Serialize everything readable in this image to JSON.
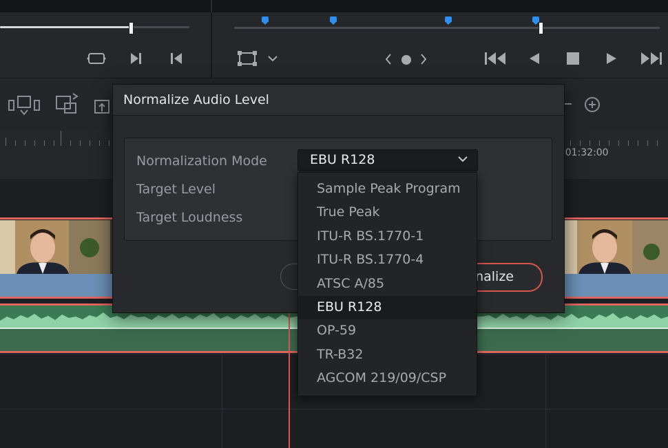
{
  "dialog": {
    "title": "Normalize Audio Level",
    "labels": {
      "mode": "Normalization Mode",
      "target_level": "Target Level",
      "target_loudness": "Target Loudness"
    },
    "mode_value": "EBU R128",
    "normalize_button": "Normalize",
    "normalize_visible_text": "nalize"
  },
  "dropdown": {
    "options": [
      "Sample Peak Program",
      "True Peak",
      "ITU-R BS.1770-1",
      "ITU-R BS.1770-4",
      "ATSC A/85",
      "EBU R128",
      "OP-59",
      "TR-B32",
      "AGCOM 219/09/CSP"
    ],
    "selected": "EBU R128"
  },
  "timeline": {
    "timecode": ":01:32:00"
  },
  "colors": {
    "accent_red": "#d9584e",
    "marker_blue": "#2f8ff0",
    "audio_green": "#3a7a55",
    "clip_border": "#e0665e"
  },
  "icons": {
    "viewer_left": [
      "loop-icon",
      "next-frame-icon",
      "previous-frame-icon"
    ],
    "viewer_right": [
      "transform-icon",
      "chevron-down-icon",
      "chevron-left-icon",
      "dot-icon",
      "chevron-right-icon",
      "skip-to-start-icon",
      "play-reverse-icon",
      "stop-icon",
      "play-icon",
      "skip-to-end-icon"
    ],
    "toolbar": [
      "insert-clip-icon",
      "overwrite-clip-icon",
      "replace-clip-icon",
      "zoom-in-icon"
    ]
  }
}
